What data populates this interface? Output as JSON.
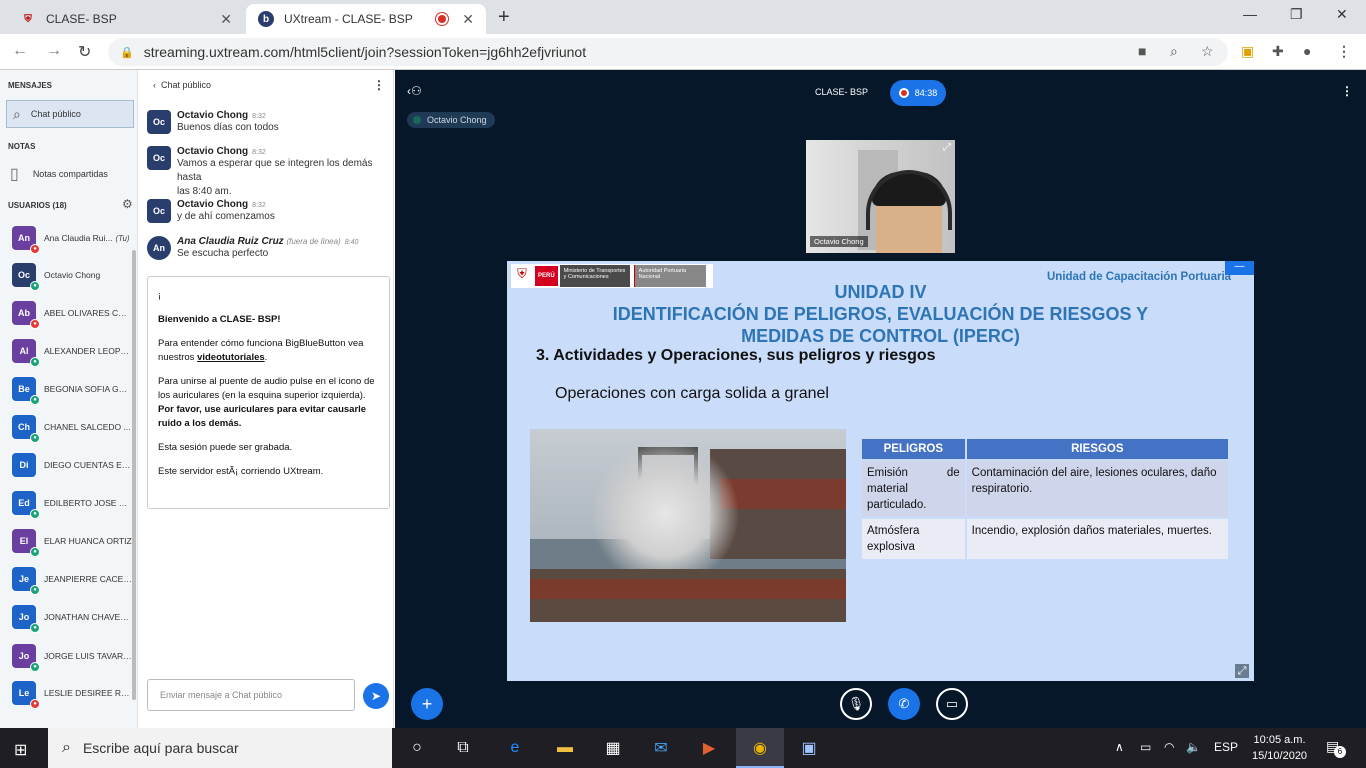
{
  "browser": {
    "tabs": [
      {
        "title": "CLASE- BSP"
      },
      {
        "title": "UXtream - CLASE- BSP"
      }
    ],
    "url": "streaming.uxtream.com/html5client/join?sessionToken=jg6hh2efjvriunot"
  },
  "sidebar": {
    "messages_label": "MENSAJES",
    "public_chat": "Chat público",
    "notes_label": "NOTAS",
    "shared_notes": "Notas compartidas",
    "users_label": "USUARIOS (18)",
    "you_tag": "(Tu)",
    "users": [
      {
        "initials": "An",
        "name": "Ana Claudia Rui...",
        "color": "#6b3fa0",
        "badge": "#e53935"
      },
      {
        "initials": "Oc",
        "name": "Octavio Chong",
        "color": "#2a3e6e",
        "badge": "#1aa37a"
      },
      {
        "initials": "Ab",
        "name": "ABEL OLIVARES CAR...",
        "color": "#6b3fa0",
        "badge": "#e53935"
      },
      {
        "initials": "Al",
        "name": "ALEXANDER LEOPO...",
        "color": "#6b3fa0",
        "badge": "#1aa37a"
      },
      {
        "initials": "Be",
        "name": "BEGONIA SOFIA GO...",
        "color": "#1e63c7",
        "badge": "#1aa37a"
      },
      {
        "initials": "Ch",
        "name": "CHANEL SALCEDO ...",
        "color": "#1e63c7",
        "badge": "#1aa37a"
      },
      {
        "initials": "Di",
        "name": "DIEGO CUENTAS ELI...",
        "color": "#1e63c7",
        "badge": ""
      },
      {
        "initials": "Ed",
        "name": "EDILBERTO JOSE VI...",
        "color": "#1e63c7",
        "badge": "#1aa37a"
      },
      {
        "initials": "El",
        "name": "ELAR HUANCA ORTIZ",
        "color": "#6b3fa0",
        "badge": "#1aa37a"
      },
      {
        "initials": "Je",
        "name": "JEANPIERRE CACER...",
        "color": "#1e63c7",
        "badge": "#1aa37a"
      },
      {
        "initials": "Jo",
        "name": "JONATHAN CHAVEZ...",
        "color": "#1e63c7",
        "badge": "#1aa37a"
      },
      {
        "initials": "Jo",
        "name": "JORGE LUIS TAVARA...",
        "color": "#6b3fa0",
        "badge": "#1aa37a"
      },
      {
        "initials": "Le",
        "name": "LESLIE DESIREE RO...",
        "color": "#1e63c7",
        "badge": "#e53935"
      }
    ]
  },
  "chat": {
    "header": "Chat público",
    "messages": [
      {
        "initials": "Oc",
        "user": "Octavio Chong",
        "time": "8:32",
        "lines": [
          "Buenos días con todos"
        ]
      },
      {
        "initials": "Oc",
        "user": "Octavio Chong",
        "time": "8:32",
        "lines": [
          "Vamos a esperar que se integren los demás hasta",
          "las 8:40 am."
        ]
      },
      {
        "initials": "Oc",
        "user": "Octavio Chong",
        "time": "8:32",
        "lines": [
          "y de ahí comenzamos"
        ]
      },
      {
        "initials": "An",
        "user": "Ana Claudia Ruiz Cruz",
        "offline": "(fuera de línea)",
        "time": "8:40",
        "lines": [
          "Se escucha perfecto"
        ]
      }
    ],
    "welcome": {
      "p1": "¡",
      "p2a": "Bienvenido a ",
      "p2b": "CLASE- BSP",
      "p2c": "!",
      "p3a": "Para entender cómo funciona BigBlueButton vea nuestros ",
      "p3link": "videotutoriales",
      "p3c": ".",
      "p4a": "Para unirse al puente de audio pulse en el icono de los auriculares (en la esquina superior izquierda). ",
      "p4b": "Por favor, use auriculares para evitar causarle ruido a los demás.",
      "p5": "Esta sesión puede ser grabada.",
      "p6": "Este servidor estÃ¡ corriendo UXtream."
    },
    "input_placeholder": "Enviar mensaje a Chat público"
  },
  "stage": {
    "meeting_title": "CLASE- BSP",
    "timer": "84:38",
    "talker": "Octavio Chong",
    "webcam_name": "Octavio Chong"
  },
  "slide": {
    "logo_peru": "PERÚ",
    "logo_ministry": "Ministerio de Transportes y Comunicaciones",
    "logo_authority": "Autoridad Portuaria Nacional",
    "unit_label": "Unidad de Capacitación Portuaria",
    "title_line1": "UNIDAD IV",
    "title_line2": "IDENTIFICACIÓN DE PELIGROS, EVALUACIÓN DE RIESGOS Y",
    "title_line3": "MEDIDAS DE CONTROL (IPERC)",
    "heading": "3. Actividades y Operaciones, sus peligros y riesgos",
    "subheading": "Operaciones con carga solida a granel",
    "table": {
      "headers": [
        "PELIGROS",
        "RIESGOS"
      ],
      "rows": [
        {
          "peligro_a": "Emisión de material",
          "peligro_b": "particulado.",
          "riesgo": "Contaminación del aire, lesiones oculares, daño respiratorio."
        },
        {
          "peligro_a": "Atmósfera explosiva",
          "peligro_b": "",
          "riesgo": "Incendio, explosión daños materiales, muertes."
        }
      ]
    }
  },
  "taskbar": {
    "search_placeholder": "Escribe aquí para buscar",
    "language": "ESP",
    "time": "10:05 a.m.",
    "date": "15/10/2020",
    "notifications": "6"
  }
}
